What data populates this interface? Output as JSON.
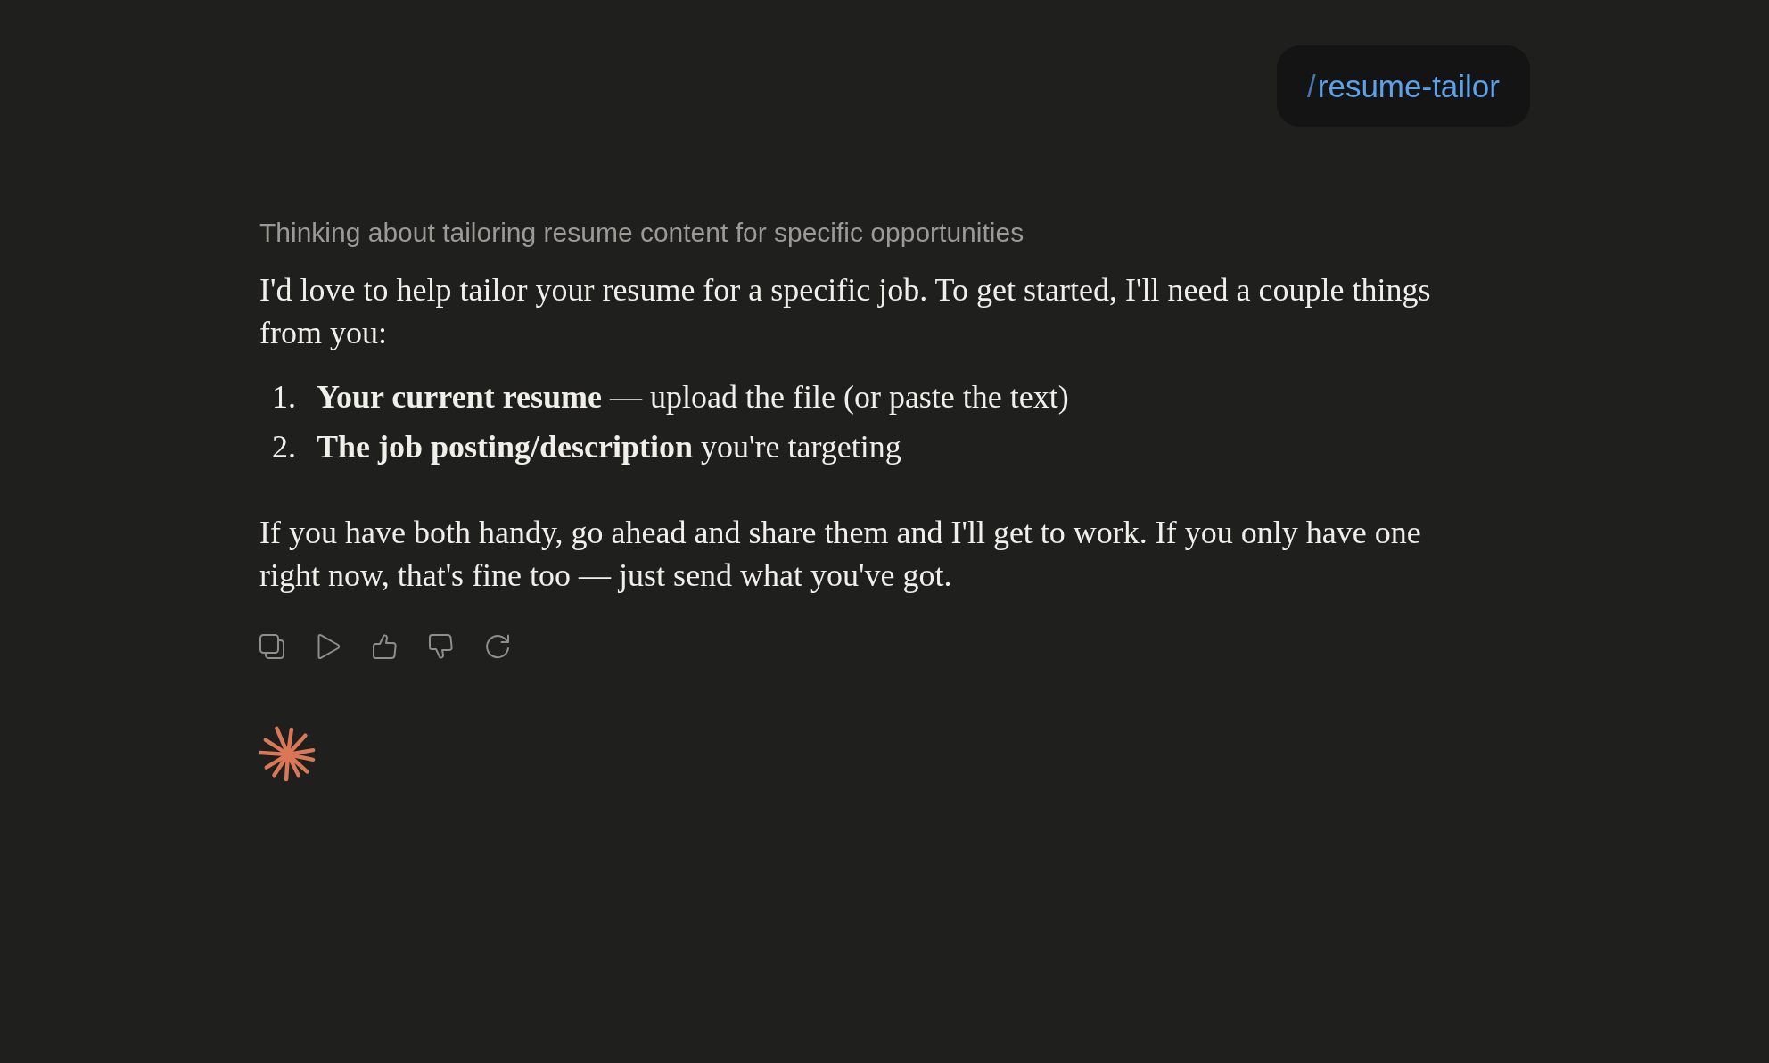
{
  "user_message": {
    "text": "/resume-tailor"
  },
  "assistant_message": {
    "thinking": "Thinking about tailoring resume content for specific opportunities",
    "blocks": [
      {
        "kind": "paragraph",
        "text": "I'd love to help tailor your resume for a specific job. To get started, I'll need a couple things from you:"
      },
      {
        "kind": "list",
        "items": [
          {
            "number": "1.",
            "text": "**Your current resume** — upload the file (or paste the text)"
          },
          {
            "number": "2.",
            "text": "**The job posting/description** you're targeting"
          }
        ]
      },
      {
        "kind": "paragraph",
        "text": "If you have both handy, go ahead and share them and I'll get to work. If you only have one right now, that's fine too — just send what you've got."
      }
    ]
  }
}
